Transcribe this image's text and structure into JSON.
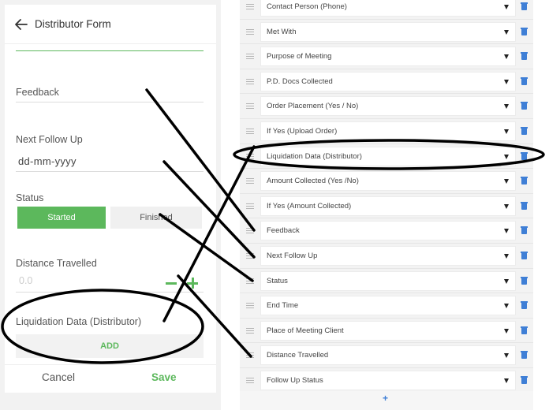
{
  "form": {
    "title": "Distributor Form",
    "feedback_label": "Feedback",
    "next_follow_up_label": "Next Follow Up",
    "next_follow_up_value": "dd-mm-yyyy",
    "status_label": "Status",
    "status_options": [
      "Started",
      "Finished"
    ],
    "distance_label": "Distance Travelled",
    "distance_value": "0.0",
    "liquidation_label": "Liquidation Data (Distributor)",
    "add_button": "ADD",
    "cancel_button": "Cancel",
    "save_button": "Save"
  },
  "builder": {
    "fields": [
      "Contact Person (Phone)",
      "Met With",
      "Purpose of Meeting",
      "P.D. Docs Collected",
      "Order Placement (Yes / No)",
      "If Yes (Upload Order)",
      "Liquidation Data (Distributor)",
      "Amount Collected (Yes /No)",
      "If Yes (Amount Collected)",
      "Feedback",
      "Next Follow Up",
      "Status",
      "End Time",
      "Place of Meeting Client",
      "Distance Travelled",
      "Follow Up Status"
    ],
    "add_label": "+"
  },
  "colors": {
    "accent_green": "#5cb85c",
    "trash_blue": "#3f7fd6",
    "annotation": "#000000"
  },
  "icons": [
    "back-arrow-icon",
    "drag-handle-icon",
    "dropdown-caret-icon",
    "trash-icon",
    "minus-icon",
    "plus-icon"
  ]
}
